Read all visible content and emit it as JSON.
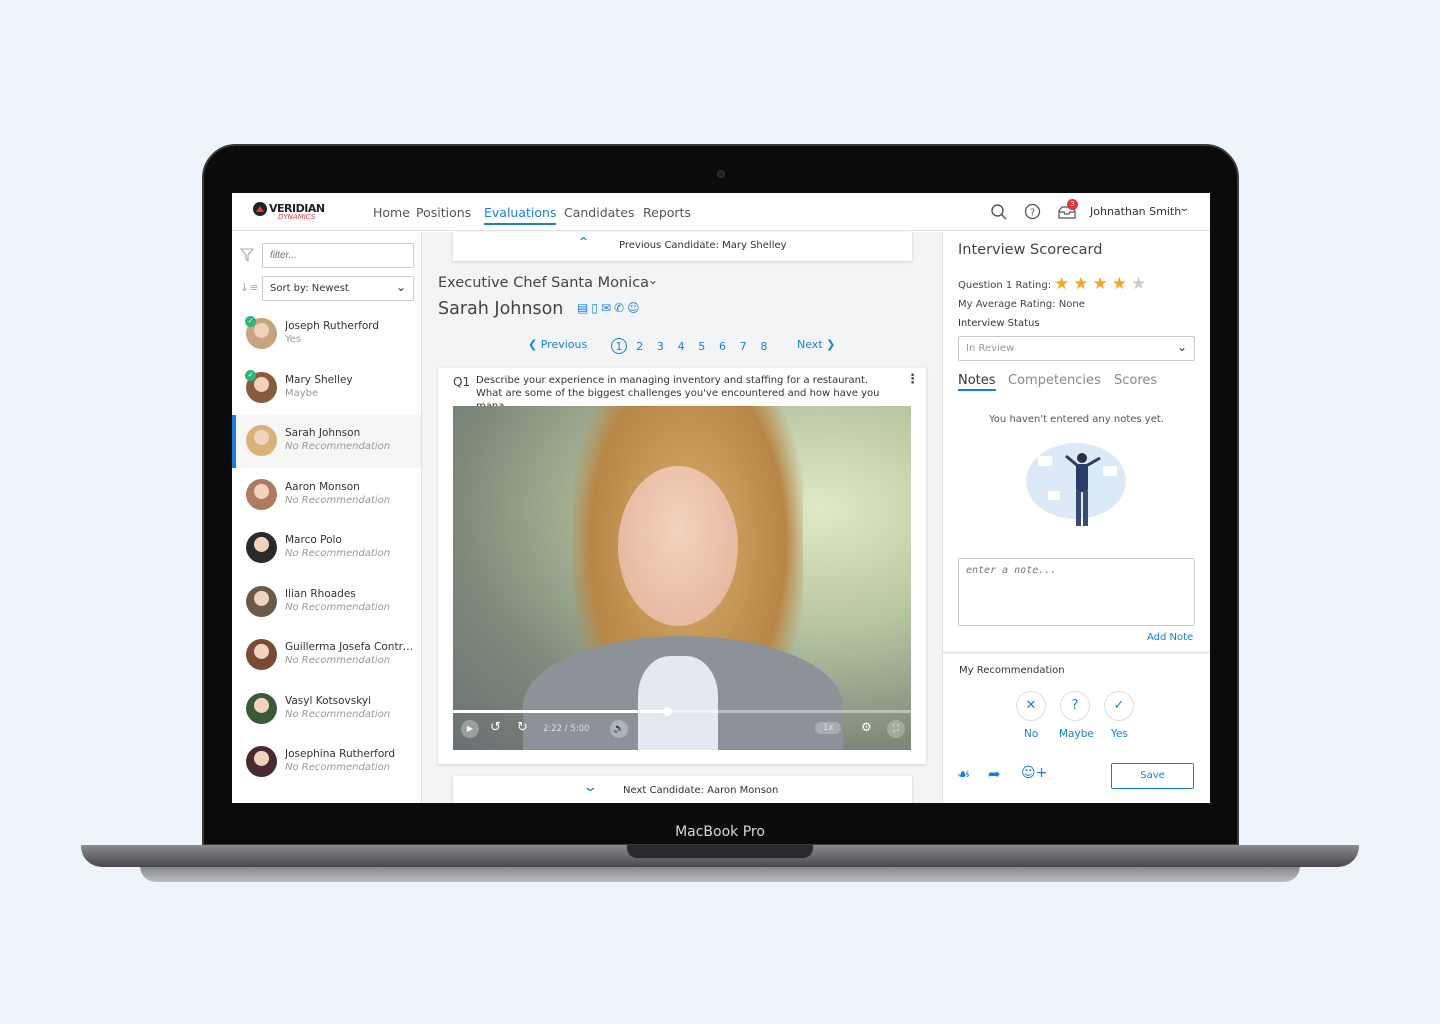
{
  "device": {
    "label": "MacBook Pro"
  },
  "header": {
    "logo_top": "VERIDIAN",
    "logo_bottom": "DYNAMICS",
    "nav": [
      "Home",
      "Positions",
      "Evaluations",
      "Candidates",
      "Reports"
    ],
    "active_nav": "Evaluations",
    "notification_count": "3",
    "user": "Johnathan Smith"
  },
  "sidebar": {
    "filter_placeholder": "filter...",
    "sort_label": "Sort by: Newest",
    "candidates": [
      {
        "name": "Joseph Rutherford",
        "status": "Yes",
        "checked": true
      },
      {
        "name": "Mary Shelley",
        "status": "Maybe",
        "checked": true
      },
      {
        "name": "Sarah Johnson",
        "status": "No Recommendation",
        "selected": true
      },
      {
        "name": "Aaron Monson",
        "status": "No Recommendation"
      },
      {
        "name": "Marco Polo",
        "status": "No Recommendation"
      },
      {
        "name": "Ilian Rhoades",
        "status": "No Recommendation"
      },
      {
        "name": "Guillerma Josefa Contreras",
        "status": "No Recommendation"
      },
      {
        "name": "Vasyl Kotsovskyi",
        "status": "No Recommendation"
      },
      {
        "name": "Josephina Rutherford",
        "status": "No Recommendation"
      }
    ]
  },
  "main": {
    "previous_candidate": "Previous Candidate: Mary Shelley",
    "position": "Executive Chef Santa Monica",
    "candidate_name": "Sarah Johnson",
    "pagination": {
      "previous": "Previous",
      "next": "Next",
      "pages": [
        "1",
        "2",
        "3",
        "4",
        "5",
        "6",
        "7",
        "8"
      ],
      "current": "1"
    },
    "question": {
      "number": "Q1",
      "text": "Describe your experience in managing inventory and staffing for a restaurant. What are some of the biggest challenges you've encountered and how have you mana..."
    },
    "video": {
      "current_time": "2:22",
      "duration": "5:00",
      "separator": "/",
      "speed": "1x",
      "progress": 0.47
    },
    "next_candidate": "Next Candidate: Aaron Monson"
  },
  "scorecard": {
    "title": "Interview Scorecard",
    "rating_label": "Question 1 Rating:",
    "rating": 4,
    "rating_max": 5,
    "average": "My Average Rating: None",
    "status_label": "Interview Status",
    "status_value": "In Review",
    "tabs": [
      "Notes",
      "Competencies",
      "Scores"
    ],
    "active_tab": "Notes",
    "empty_notes": "You haven't entered any notes yet.",
    "note_placeholder": "enter a note...",
    "add_note": "Add Note",
    "recommendation_label": "My Recommendation",
    "options": [
      "No",
      "Maybe",
      "Yes"
    ],
    "save": "Save"
  },
  "colors": {
    "accent": "#1a7fd4",
    "star": "#f5a623",
    "check": "#2fb67c",
    "logo_red": "#e03a3a"
  }
}
